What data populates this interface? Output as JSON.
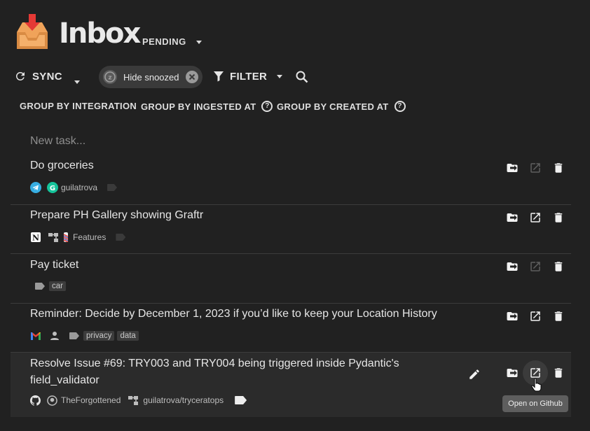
{
  "header": {
    "title": "Inbox",
    "filter_state": "PENDING"
  },
  "toolbar": {
    "sync_label": "SYNC",
    "chip_label": "Hide snoozed",
    "filter_label": "FILTER"
  },
  "groups": [
    {
      "label": "GROUP BY INTEGRATION"
    },
    {
      "label": "GROUP BY INGESTED AT"
    },
    {
      "label": "GROUP BY CREATED AT"
    }
  ],
  "new_task_placeholder": "New task...",
  "tasks": [
    {
      "title": "Do groceries",
      "meta": [
        "guilatrova"
      ]
    },
    {
      "title": "Prepare PH Gallery showing Graftr",
      "meta": [
        "Features"
      ]
    },
    {
      "title": "Pay ticket",
      "tags": [
        "car"
      ]
    },
    {
      "title": "Reminder: Decide by December 1, 2023 if you’d like to keep your Location History",
      "tags": [
        "privacy",
        "data"
      ]
    },
    {
      "title_line1": "Resolve Issue #69: TRY003 and TRY004 being triggered inside Pydantic's",
      "title_line2": "field_validator",
      "meta": [
        "TheForgottened",
        "guilatrova/tryceratops"
      ]
    }
  ],
  "tooltip": "Open on Github",
  "colors": {
    "background": "#212121",
    "selected_row": "#2b2b2b",
    "logo_red": "#e53935",
    "logo_orange": "#f0a35a"
  }
}
